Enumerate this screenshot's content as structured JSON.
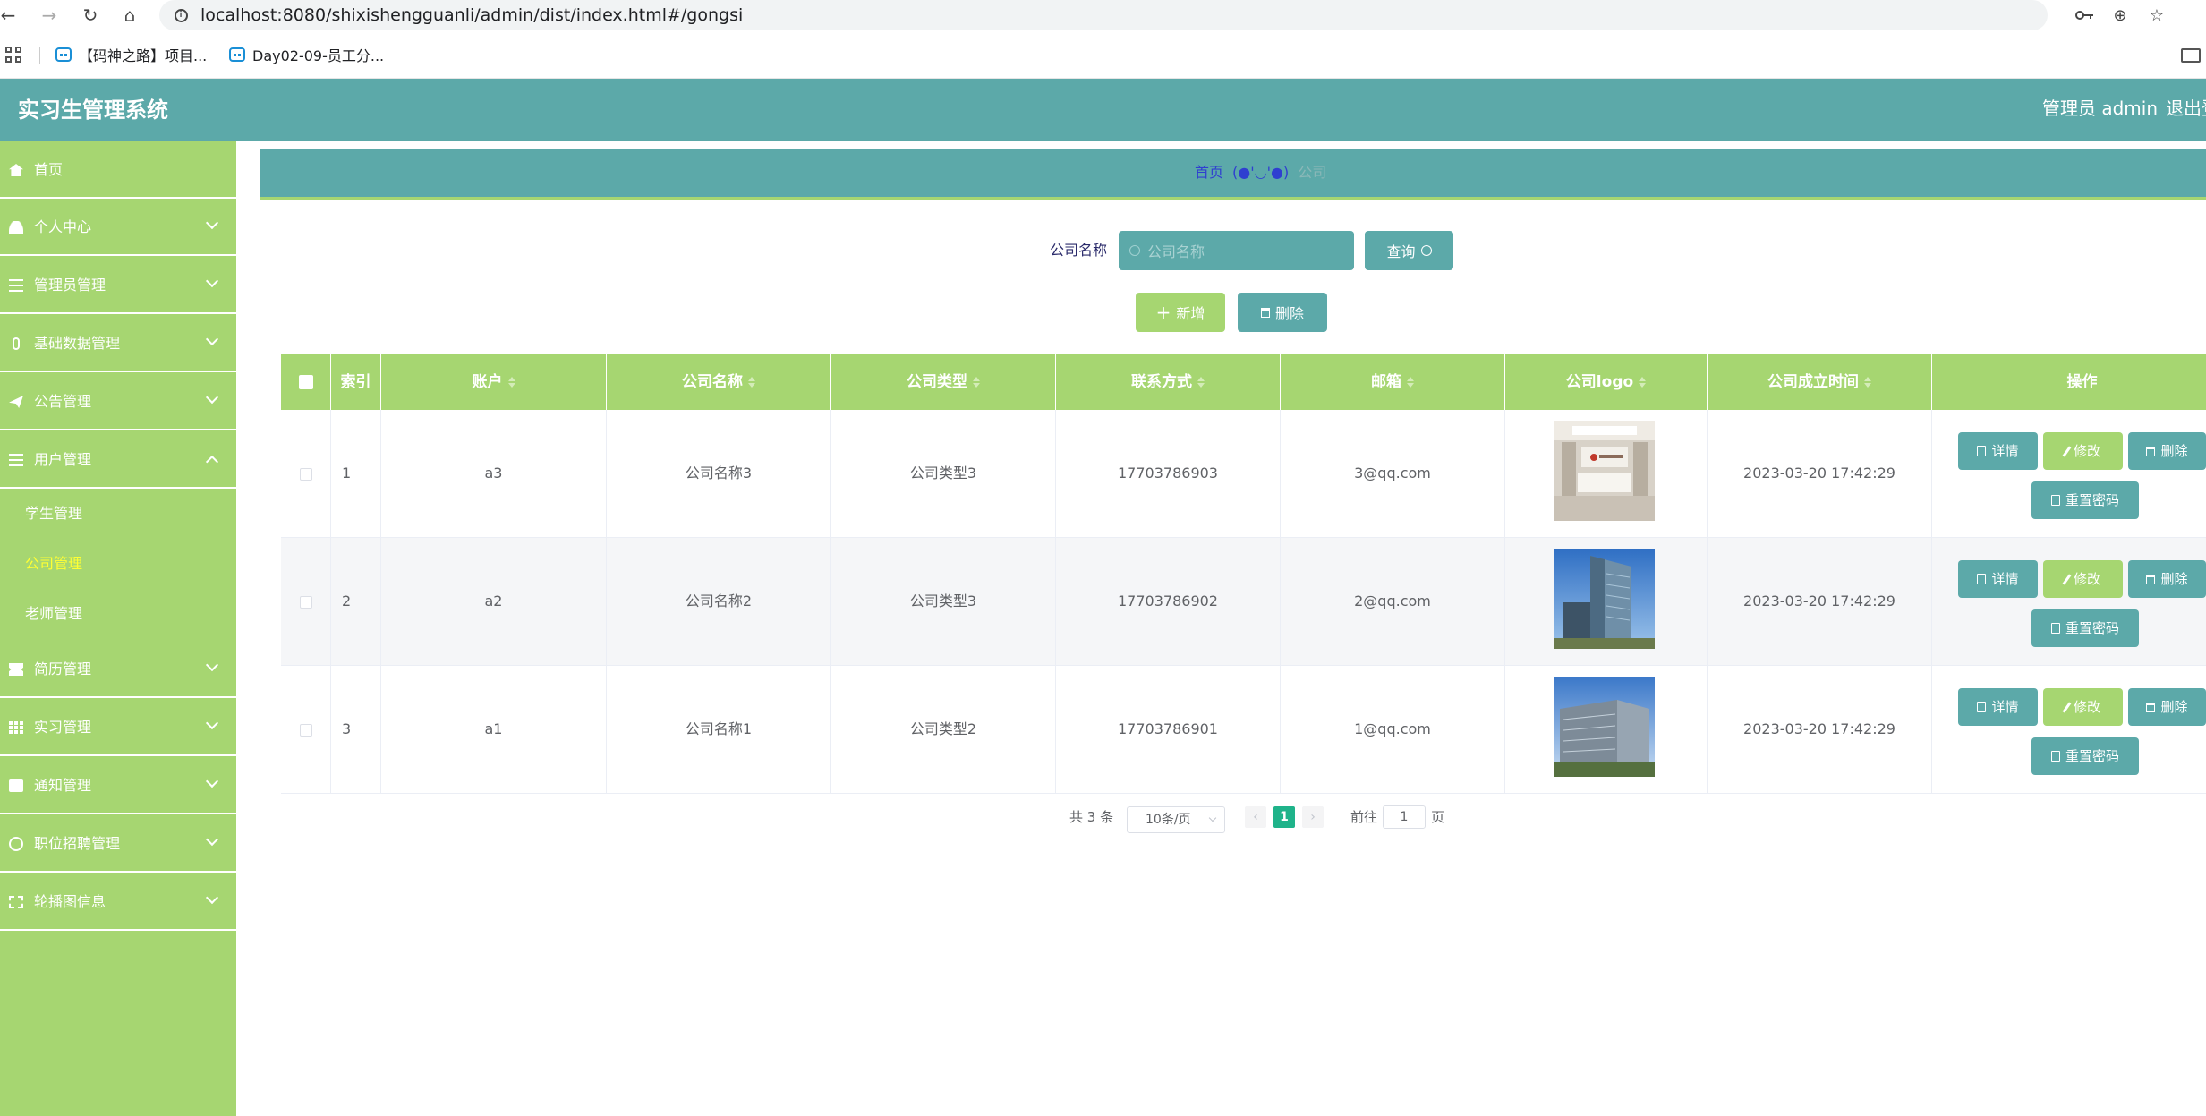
{
  "browser": {
    "url": "localhost:8080/shixishengguanli/admin/dist/index.html#/gongsi",
    "back_glyph": "←",
    "forward_glyph": "→",
    "reload_glyph": "↻",
    "home_glyph": "⌂",
    "zoom_glyph": "⊕",
    "star_glyph": "☆",
    "bookmarks": [
      "【码神之路】项目...",
      "Day02-09-员工分..."
    ]
  },
  "header": {
    "title": "实习生管理系统",
    "user_label": "管理员 admin",
    "logout_label": "退出登录",
    "color": "#5ca9a9"
  },
  "sidebar": {
    "color": "#a6d671",
    "items": [
      {
        "label": "首页",
        "icon": "home-icon"
      },
      {
        "label": "个人中心",
        "icon": "user-icon"
      },
      {
        "label": "管理员管理",
        "icon": "list-icon"
      },
      {
        "label": "基础数据管理",
        "icon": "microphone-icon"
      },
      {
        "label": "公告管理",
        "icon": "send-icon"
      },
      {
        "label": "用户管理",
        "icon": "list-icon",
        "expanded": true
      },
      {
        "label": "简历管理",
        "icon": "ticket-icon"
      },
      {
        "label": "实习管理",
        "icon": "grid-icon"
      },
      {
        "label": "通知管理",
        "icon": "printer-icon"
      },
      {
        "label": "职位招聘管理",
        "icon": "circle-icon"
      },
      {
        "label": "轮播图信息",
        "icon": "fullscreen-icon"
      }
    ],
    "submenu": [
      {
        "label": "学生管理",
        "active": false
      },
      {
        "label": "公司管理",
        "active": true
      },
      {
        "label": "老师管理",
        "active": false
      }
    ]
  },
  "breadcrumb": {
    "home": "首页",
    "separator_face": "(●'◡'●)",
    "current": "公司"
  },
  "search": {
    "label": "公司名称",
    "placeholder": "公司名称",
    "button": "查询"
  },
  "actions": {
    "add": "新增",
    "delete": "删除"
  },
  "table": {
    "headers": {
      "index": "索引",
      "account": "账户",
      "name": "公司名称",
      "type": "公司类型",
      "phone": "联系方式",
      "email": "邮箱",
      "logo": "公司logo",
      "founded": "公司成立时间",
      "ops": "操作"
    },
    "rows": [
      {
        "index": "1",
        "account": "a3",
        "name": "公司名称3",
        "type": "公司类型3",
        "phone": "17703786903",
        "email": "3@qq.com",
        "logo": "office-lobby-photo",
        "founded": "2023-03-20 17:42:29"
      },
      {
        "index": "2",
        "account": "a2",
        "name": "公司名称2",
        "type": "公司类型3",
        "phone": "17703786902",
        "email": "2@qq.com",
        "logo": "glass-tower-photo",
        "founded": "2023-03-20 17:42:29"
      },
      {
        "index": "3",
        "account": "a1",
        "name": "公司名称1",
        "type": "公司类型2",
        "phone": "17703786901",
        "email": "1@qq.com",
        "logo": "office-building-photo",
        "founded": "2023-03-20 17:42:29"
      }
    ],
    "row_actions": {
      "detail": "详情",
      "edit": "修改",
      "delete": "删除",
      "reset_password": "重置密码"
    }
  },
  "pagination": {
    "total": "共 3 条",
    "page_size": "10条/页",
    "prev": "‹",
    "next": "›",
    "current_page": "1",
    "goto_label": "前往",
    "goto_value": "1",
    "page_unit": "页"
  }
}
